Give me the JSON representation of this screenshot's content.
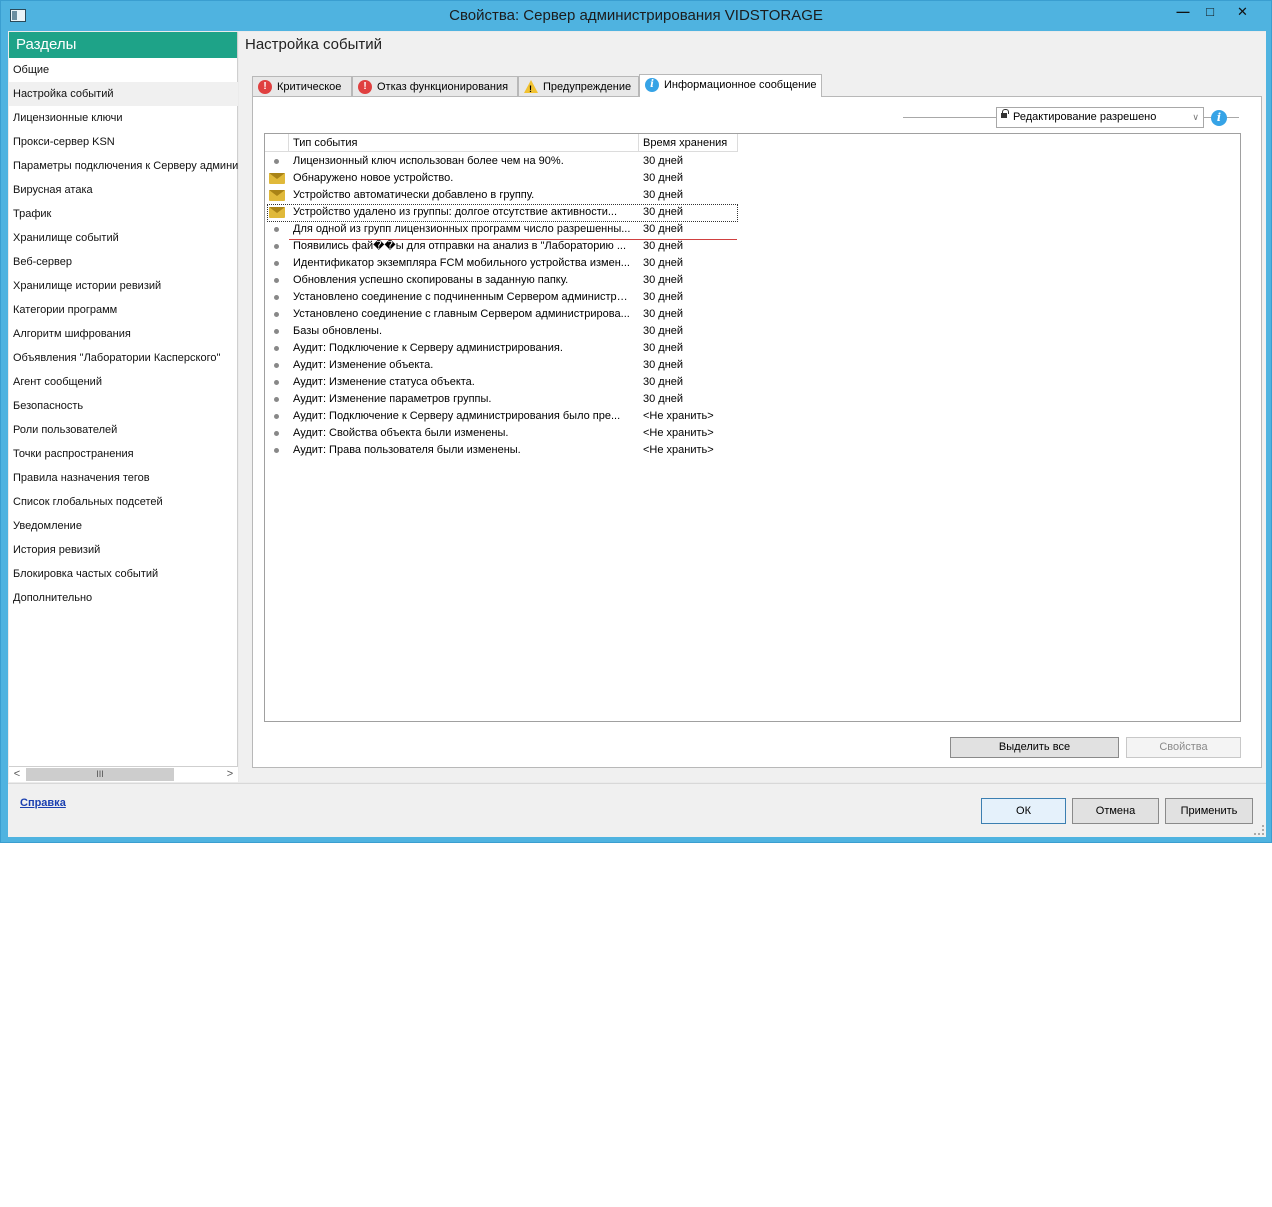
{
  "window": {
    "title": "Свойства: Сервер администрирования VIDSTORAGE",
    "min_glyph": "—",
    "max_glyph": "□",
    "close_glyph": "✕"
  },
  "sidebar": {
    "header": "Разделы",
    "items": [
      {
        "label": "Общие"
      },
      {
        "label": "Настройка событий",
        "active": true
      },
      {
        "label": "Лицензионные ключи"
      },
      {
        "label": "Прокси-сервер KSN"
      },
      {
        "label": "Параметры подключения к Серверу админи"
      },
      {
        "label": "Вирусная атака"
      },
      {
        "label": "Трафик"
      },
      {
        "label": "Хранилище событий"
      },
      {
        "label": "Веб-сервер"
      },
      {
        "label": "Хранилище истории ревизий"
      },
      {
        "label": "Категории программ"
      },
      {
        "label": "Алгоритм шифрования"
      },
      {
        "label": "Объявления \"Лаборатории Касперского\""
      },
      {
        "label": "Агент сообщений"
      },
      {
        "label": "Безопасность"
      },
      {
        "label": "Роли пользователей"
      },
      {
        "label": "Точки распространения"
      },
      {
        "label": "Правила назначения тегов"
      },
      {
        "label": "Список глобальных подсетей"
      },
      {
        "label": "Уведомление"
      },
      {
        "label": "История ревизий"
      },
      {
        "label": "Блокировка частых событий"
      },
      {
        "label": "Дополнительно"
      }
    ],
    "scroll_left": "<",
    "scroll_right": ">",
    "scroll_thumb": "III"
  },
  "main": {
    "title": "Настройка событий",
    "tabs": [
      {
        "label": "Критическое",
        "icon": "critical-icon",
        "icon_glyph": "!"
      },
      {
        "label": "Отказ функционирования",
        "icon": "failure-icon",
        "icon_glyph": "!"
      },
      {
        "label": "Предупреждение",
        "icon": "warning-icon",
        "icon_glyph": "!"
      },
      {
        "label": "Информационное сообщение",
        "icon": "info-icon",
        "icon_glyph": "i",
        "active": true
      }
    ],
    "permission": "Редактирование разрешено",
    "permission_chevron": "∨",
    "info_glyph": "i",
    "columns": {
      "type": "Тип события",
      "time": "Время хранения"
    },
    "rows": [
      {
        "icon": "dot",
        "type": "Лицензионный ключ использован более чем на 90%.",
        "time": "30 дней"
      },
      {
        "icon": "mail",
        "type": "Обнаружено новое устройство.",
        "time": "30 дней"
      },
      {
        "icon": "mail",
        "type": "Устройство автоматически добавлено в группу.",
        "time": "30 дней"
      },
      {
        "icon": "mail",
        "type": "Устройство удалено из группы: долгое отсутствие активности...",
        "time": "30 дней",
        "focus": true
      },
      {
        "icon": "dot",
        "type": "Для одной из групп лицензионных программ число разрешенны...",
        "time": "30 дней"
      },
      {
        "icon": "dot",
        "type": "Появились фай��ы для отправки на анализ в \"Лабораторию ...",
        "time": "30 дней"
      },
      {
        "icon": "dot",
        "type": "Идентификатор экземпляра FCM мобильного устройства измен...",
        "time": "30 дней"
      },
      {
        "icon": "dot",
        "type": "Обновления успешно скопированы в заданную папку.",
        "time": "30 дней"
      },
      {
        "icon": "dot",
        "type": "Установлено соединение с подчиненным Сервером администри...",
        "time": "30 дней"
      },
      {
        "icon": "dot",
        "type": "Установлено соединение с главным Сервером администрирова...",
        "time": "30 дней"
      },
      {
        "icon": "dot",
        "type": "Базы обновлены.",
        "time": "30 дней"
      },
      {
        "icon": "dot",
        "type": "Аудит: Подключение к Серверу администрирования.",
        "time": "30 дней"
      },
      {
        "icon": "dot",
        "type": "Аудит: Изменение объекта.",
        "time": "30 дней"
      },
      {
        "icon": "dot",
        "type": "Аудит: Изменение статуса объекта.",
        "time": "30 дней"
      },
      {
        "icon": "dot",
        "type": "Аудит: Изменение параметров группы.",
        "time": "30 дней"
      },
      {
        "icon": "dot",
        "type": "Аудит: Подключение к Серверу администрирования было пре...",
        "time": "<Не хранить>"
      },
      {
        "icon": "dot",
        "type": "Аудит: Свойства объекта были изменены.",
        "time": "<Не хранить>"
      },
      {
        "icon": "dot",
        "type": "Аудит: Права пользователя были изменены.",
        "time": "<Не хранить>"
      }
    ],
    "select_all_label": "Выделить все",
    "properties_label": "Свойства"
  },
  "footer": {
    "help_label": "Справка",
    "ok_label": "ОК",
    "cancel_label": "Отмена",
    "apply_label": "Применить"
  },
  "colors": {
    "titlebar": "#4fb3e0",
    "sidebar_header": "#1ea388",
    "link": "#1a3fb0",
    "accent_line": "#d04040"
  }
}
